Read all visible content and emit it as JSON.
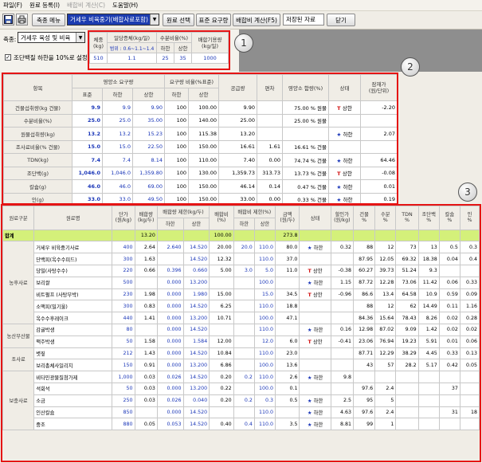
{
  "menu": {
    "file": "파일(F)",
    "register": "원료 등록(I)",
    "calc": "배합비 계산(C)",
    "help": "도움말(H)"
  },
  "toolbar": {
    "species_menu": "축종 메뉴",
    "formula_combo": "거세우 비육중기(배합사료포함)",
    "ingredient_select": "원료 선택",
    "standard_req": "표준 요구량",
    "calc_formula": "배합비 계산(F5)",
    "saved_data": "저장된 자료",
    "close": "닫기"
  },
  "settings": {
    "species_label": "축종:",
    "species_value": "거세우 육성 및 비육",
    "crude_fiber_check": "조단백질 하한을 10%로 설정",
    "table_headers": {
      "weight": "체중",
      "weight_unit": "(kg)",
      "adg": "일당증체(kg/일)",
      "moisture": "수분비율(%)",
      "intake": "배합기용량",
      "intake_unit": "(kg/일)",
      "range": "범위 : 0.6~1.1~1.4",
      "lower": "하한",
      "upper": "상한"
    },
    "values": {
      "weight": "510",
      "adg": "1.1",
      "moist_lower": "25",
      "moist_upper": "35",
      "intake": "1000"
    }
  },
  "nutrients": {
    "headers": {
      "item": "항목",
      "req": "영양소 요구량",
      "std": "표준",
      "low": "하한",
      "up": "상한",
      "req_pct": "요구량 비율(%표준)",
      "supply": "공급량",
      "excess": "편차",
      "content": "영양소 함량(%)",
      "status": "상태",
      "margin": "잠재가",
      "margin2": "(원/단위)"
    },
    "rows": [
      {
        "name": "건물섭취량(kg 건물)",
        "std": "9.9",
        "low": "9.9",
        "up": "9.90",
        "rl": "100",
        "ru": "100.00",
        "supply": "9.90",
        "dev": "",
        "content": "75.00 % 원물",
        "status": "상한",
        "dir": "up",
        "margin": "-2.20"
      },
      {
        "name": "수분비율(%)",
        "std": "25.0",
        "low": "25.0",
        "up": "35.00",
        "rl": "100",
        "ru": "140.00",
        "supply": "25.00",
        "dev": "",
        "content": "25.00 % 원물",
        "status": "",
        "dir": "",
        "margin": ""
      },
      {
        "name": "원물섭취량(kg)",
        "std": "13.2",
        "low": "13.2",
        "up": "15.23",
        "rl": "100",
        "ru": "115.38",
        "supply": "13.20",
        "dev": "",
        "content": "",
        "status": "하한",
        "dir": "down",
        "margin": "2.07"
      },
      {
        "name": "조사료비율(% 건물)",
        "std": "15.0",
        "low": "15.0",
        "up": "22.50",
        "rl": "100",
        "ru": "150.00",
        "supply": "16.61",
        "dev": "1.61",
        "content": "16.61 % 건물",
        "status": "",
        "dir": "",
        "margin": ""
      },
      {
        "name": "TDN(kg)",
        "std": "7.4",
        "low": "7.4",
        "up": "8.14",
        "rl": "100",
        "ru": "110.00",
        "supply": "7.40",
        "dev": "0.00",
        "content": "74.74 % 건물",
        "status": "하한",
        "dir": "down",
        "margin": "64.46"
      },
      {
        "name": "조단백(g)",
        "std": "1,046.0",
        "low": "1,046.0",
        "up": "1,359.80",
        "rl": "100",
        "ru": "130.00",
        "supply": "1,359.73",
        "dev": "313.73",
        "content": "13.73 % 건물",
        "status": "상한",
        "dir": "up",
        "margin": "-0.08"
      },
      {
        "name": "칼슘(g)",
        "std": "46.0",
        "low": "46.0",
        "up": "69.00",
        "rl": "100",
        "ru": "150.00",
        "supply": "46.14",
        "dev": "0.14",
        "content": "0.47 % 건물",
        "status": "하한",
        "dir": "down",
        "margin": "0.01"
      },
      {
        "name": "인(g)",
        "std": "33.0",
        "low": "33.0",
        "up": "49.50",
        "rl": "100",
        "ru": "150.00",
        "supply": "33.00",
        "dev": "0.00",
        "content": "0.33 % 건물",
        "status": "하한",
        "dir": "down",
        "margin": "0.19"
      }
    ]
  },
  "ingredients": {
    "headers": {
      "cat": "원료구분",
      "name": "원료명",
      "price": "단가",
      "price_u": "(원/kg)",
      "ratio": "배합량",
      "ratio_u": "(kg/두)",
      "limit": "배합량 제한(kg/두)",
      "lo": "하한",
      "hi": "상한",
      "pct": "배합비",
      "pct_u": "(%)",
      "rlimit": "배합비 제한(%)",
      "cost": "금액",
      "cost_u": "(원/두)",
      "state": "상태",
      "margin": "할인가",
      "margin_u": "(원/kg)",
      "dm": "건물",
      "moist": "수분",
      "tdn": "TDN",
      "cp": "조단백",
      "ca": "칼슘",
      "p": "인",
      "pctu": "%"
    },
    "total": {
      "label": "합계",
      "ratio": "13.20",
      "pct": "100.00",
      "cost": "273.8"
    },
    "categories": {
      "feed": "농후사료",
      "byproduct": "농산부산물",
      "roughage": "조사료",
      "supplement": "보충사료"
    },
    "rows": [
      {
        "name": "거세우 비육중기사료",
        "price": "400",
        "ratio": "2.64",
        "lo": "2.640",
        "hi": "14.520",
        "pct": "20.00",
        "plo": "20.0",
        "phi": "110.0",
        "cost": "80.0",
        "state": "하한",
        "dir": "down",
        "margin": "0.32",
        "dm": "88",
        "mo": "12",
        "tdn": "73",
        "cp": "13",
        "ca": "0.5",
        "p": "0.3"
      },
      {
        "name": "단백피(옥수수피드)",
        "price": "300",
        "ratio": "1.63",
        "lo": "",
        "hi": "14.520",
        "pct": "12.32",
        "plo": "",
        "phi": "110.0",
        "cost": "37.0",
        "state": "",
        "dir": "",
        "margin": "",
        "dm": "87.95",
        "mo": "12.05",
        "tdn": "69.32",
        "cp": "18.38",
        "ca": "0.04",
        "p": "0.4"
      },
      {
        "name": "당밀(사탕수수)",
        "price": "220",
        "ratio": "0.66",
        "lo": "0.396",
        "hi": "0.660",
        "pct": "5.00",
        "plo": "3.0",
        "phi": "5.0",
        "cost": "11.0",
        "state": "상한",
        "dir": "up",
        "margin": "-0.38",
        "dm": "60.27",
        "mo": "39.73",
        "tdn": "51.24",
        "cp": "9.3",
        "ca": "",
        "p": ""
      },
      {
        "name": "보리쌀",
        "price": "500",
        "ratio": "",
        "lo": "0.000",
        "hi": "13.200",
        "pct": "",
        "plo": "",
        "phi": "100.0",
        "cost": "",
        "state": "하한",
        "dir": "down",
        "margin": "1.15",
        "dm": "87.72",
        "mo": "12.28",
        "tdn": "73.06",
        "cp": "11.42",
        "ca": "0.06",
        "p": "0.33"
      },
      {
        "name": "비트펄프 (사탕무박)",
        "price": "230",
        "ratio": "1.98",
        "lo": "0.000",
        "hi": "1.980",
        "pct": "15.00",
        "plo": "",
        "phi": "15.0",
        "cost": "34.5",
        "state": "상한",
        "dir": "up",
        "margin": "-0.96",
        "dm": "86.6",
        "mo": "13.4",
        "tdn": "64.58",
        "cp": "10.9",
        "ca": "0.59",
        "p": "0.09"
      },
      {
        "name": "소맥피(밀기울)",
        "price": "300",
        "ratio": "0.83",
        "lo": "0.000",
        "hi": "14.520",
        "pct": "6.25",
        "plo": "",
        "phi": "110.0",
        "cost": "18.8",
        "state": "",
        "dir": "",
        "margin": "",
        "dm": "88",
        "mo": "12",
        "tdn": "62",
        "cp": "14.49",
        "ca": "0.11",
        "p": "1.16"
      },
      {
        "name": "옥수수후레이크",
        "price": "440",
        "ratio": "1.41",
        "lo": "0.000",
        "hi": "13.200",
        "pct": "10.71",
        "plo": "",
        "phi": "100.0",
        "cost": "47.1",
        "state": "",
        "dir": "",
        "margin": "",
        "dm": "84.36",
        "mo": "15.64",
        "tdn": "78.43",
        "cp": "8.26",
        "ca": "0.02",
        "p": "0.28"
      },
      {
        "name": "감귤박생",
        "price": "80",
        "ratio": "",
        "lo": "0.000",
        "hi": "14.520",
        "pct": "",
        "plo": "",
        "phi": "110.0",
        "cost": "",
        "state": "하한",
        "dir": "down",
        "margin": "0.16",
        "dm": "12.98",
        "mo": "87.02",
        "tdn": "9.09",
        "cp": "1.42",
        "ca": "0.02",
        "p": "0.02"
      },
      {
        "name": "맥주박생",
        "price": "50",
        "ratio": "1.58",
        "lo": "0.000",
        "hi": "1.584",
        "pct": "12.00",
        "plo": "",
        "phi": "12.0",
        "cost": "6.0",
        "state": "상한",
        "dir": "up",
        "margin": "-0.41",
        "dm": "23.06",
        "mo": "76.94",
        "tdn": "19.23",
        "cp": "5.91",
        "ca": "0.01",
        "p": "0.06"
      },
      {
        "name": "볏짚",
        "price": "212",
        "ratio": "1.43",
        "lo": "0.000",
        "hi": "14.520",
        "pct": "10.84",
        "plo": "",
        "phi": "110.0",
        "cost": "23.0",
        "state": "",
        "dir": "",
        "margin": "",
        "dm": "87.71",
        "mo": "12.29",
        "tdn": "38.29",
        "cp": "4.45",
        "ca": "0.33",
        "p": "0.13"
      },
      {
        "name": "보리총체사일리지",
        "price": "150",
        "ratio": "0.91",
        "lo": "0.000",
        "hi": "13.200",
        "pct": "6.86",
        "plo": "",
        "phi": "100.0",
        "cost": "13.6",
        "state": "",
        "dir": "",
        "margin": "",
        "dm": "43",
        "mo": "57",
        "tdn": "28.2",
        "cp": "5.17",
        "ca": "0.42",
        "p": "0.05"
      },
      {
        "name": "비타민광물질첨가제",
        "price": "1,000",
        "ratio": "0.03",
        "lo": "0.026",
        "hi": "14.520",
        "pct": "0.20",
        "plo": "0.2",
        "phi": "110.0",
        "cost": "2.6",
        "state": "하한",
        "dir": "down",
        "margin": "9.8",
        "dm": "",
        "mo": "",
        "tdn": "",
        "cp": "",
        "ca": "",
        "p": ""
      },
      {
        "name": "석회석",
        "price": "50",
        "ratio": "0.03",
        "lo": "0.000",
        "hi": "13.200",
        "pct": "0.22",
        "plo": "",
        "phi": "100.0",
        "cost": "0.1",
        "state": "",
        "dir": "",
        "margin": "",
        "dm": "97.6",
        "mo": "2.4",
        "tdn": "",
        "cp": "",
        "ca": "37",
        "p": ""
      },
      {
        "name": "소금",
        "price": "250",
        "ratio": "0.03",
        "lo": "0.026",
        "hi": "0.040",
        "pct": "0.20",
        "plo": "0.2",
        "phi": "0.3",
        "cost": "0.5",
        "state": "하한",
        "dir": "down",
        "margin": "2.5",
        "dm": "95",
        "mo": "5",
        "tdn": "",
        "cp": "",
        "ca": "",
        "p": ""
      },
      {
        "name": "인산칼슘",
        "price": "850",
        "ratio": "",
        "lo": "0.000",
        "hi": "14.520",
        "pct": "",
        "plo": "",
        "phi": "110.0",
        "cost": "",
        "state": "하한",
        "dir": "down",
        "margin": "4.63",
        "dm": "97.6",
        "mo": "2.4",
        "tdn": "",
        "cp": "",
        "ca": "31",
        "p": "18"
      },
      {
        "name": "중조",
        "price": "880",
        "ratio": "0.05",
        "lo": "0.053",
        "hi": "14.520",
        "pct": "0.40",
        "plo": "0.4",
        "phi": "110.0",
        "cost": "3.5",
        "state": "하한",
        "dir": "down",
        "margin": "8.81",
        "dm": "99",
        "mo": "1",
        "tdn": "",
        "cp": "",
        "ca": "",
        "p": ""
      }
    ]
  },
  "callouts": {
    "one": "1",
    "two": "2",
    "three": "3"
  },
  "colors": {
    "accent_blue": "#1a36b8",
    "warning_red": "#d21010",
    "highlight": "#d4f07a",
    "callout_border": "#e51414"
  }
}
